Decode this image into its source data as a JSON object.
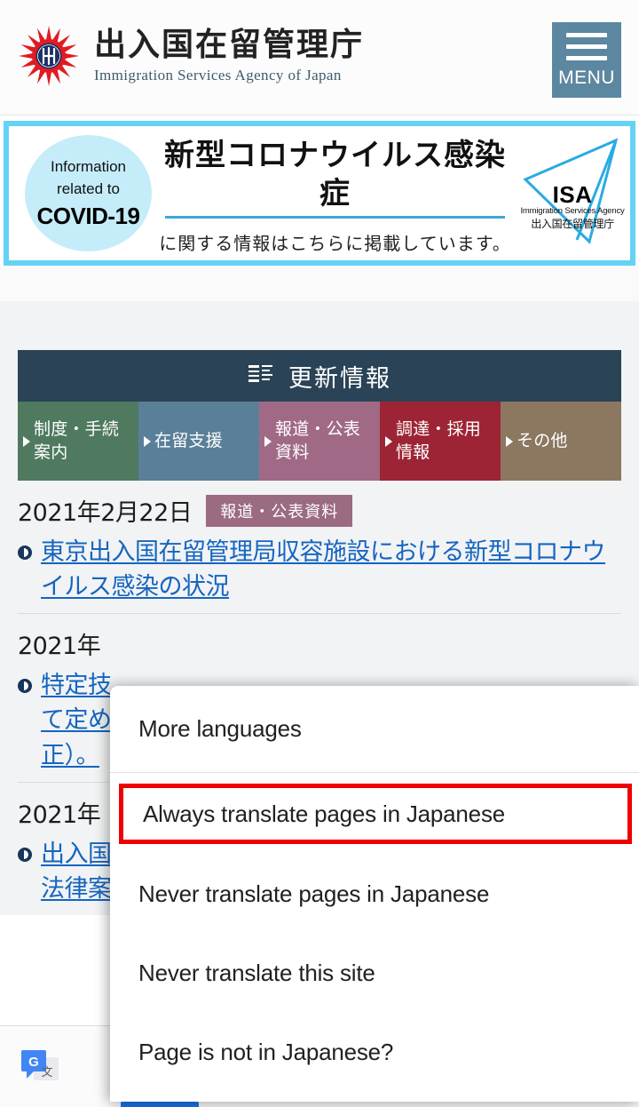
{
  "header": {
    "title_jp": "出入国在留管理庁",
    "title_en": "Immigration Services Agency of Japan",
    "menu_label": "MENU",
    "crest_icon": "chrysanthemum-crest-icon",
    "hamburger_icon": "hamburger-icon"
  },
  "covid_banner": {
    "circle_line1": "Information",
    "circle_line2": "related to",
    "circle_line3": "COVID-19",
    "title": "新型コロナウイルス感染症",
    "subtitle": "に関する情報はこちらに掲載しています。",
    "logo": {
      "abbr": "ISA",
      "english": "Immigration Services Agency",
      "japanese": "出入国在留管理庁",
      "icon": "isa-triangle-logo-icon"
    },
    "border_color": "#64d2f5",
    "circle_color": "#c5ecf9",
    "rule_color": "#3ba7d6"
  },
  "news_panel": {
    "heading": "更新情報",
    "heading_icon": "news-document-icon",
    "heading_bg": "#2b4356",
    "tabs": [
      {
        "label": "制度・手続\n案内",
        "color": "#4f7a5f"
      },
      {
        "label": "在留支援",
        "color": "#5a7f99"
      },
      {
        "label": "報道・公表\n資料",
        "color": "#a06a86"
      },
      {
        "label": "調達・採用\n情報",
        "color": "#9d2434"
      },
      {
        "label": "その他",
        "color": "#8c7760"
      }
    ],
    "items": [
      {
        "date": "2021年2月22日",
        "badge": "報道・公表資料",
        "badge_color": "#9b6b82",
        "link": "東京出入国在留管理局収容施設における新型コロナウイルス感染の状況"
      },
      {
        "date": "2021年",
        "link": "特定技\nて定め\n正）。"
      },
      {
        "date": "2021年",
        "link": "出入国\n法律案"
      }
    ],
    "link_color": "#1565c0"
  },
  "translate_bar": {
    "logo_icon": "google-translate-icon",
    "active_tab_color": "#1a73e8"
  },
  "translate_menu": {
    "items": [
      {
        "label": "More languages",
        "highlighted": false
      },
      {
        "label": "Always translate pages in Japanese",
        "highlighted": true
      },
      {
        "label": "Never translate pages in Japanese",
        "highlighted": false
      },
      {
        "label": "Never translate this site",
        "highlighted": false
      },
      {
        "label": "Page is not in Japanese?",
        "highlighted": false
      }
    ],
    "highlight_color": "#ee0000"
  }
}
